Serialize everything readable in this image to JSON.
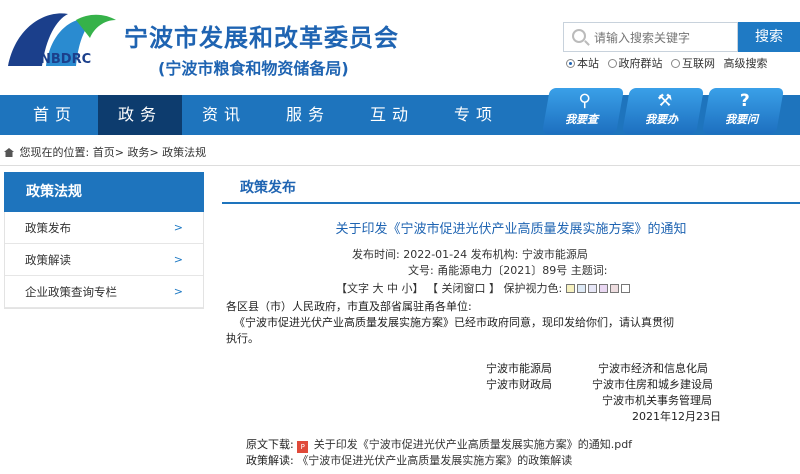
{
  "header": {
    "logo_text": "NBDRC",
    "title": "宁波市发展和改革委员会",
    "subtitle": "(宁波市粮食和物资储备局)"
  },
  "search": {
    "placeholder": "请输入搜索关键字",
    "button": "搜索",
    "options": [
      "本站",
      "政府群站",
      "互联网",
      "高级搜索"
    ]
  },
  "nav": {
    "items": [
      "首页",
      "政务",
      "资讯",
      "服务",
      "互动",
      "专项"
    ]
  },
  "quick_links": [
    {
      "icon": "search-icon",
      "label": "我要查"
    },
    {
      "icon": "tools-icon",
      "label": "我要办"
    },
    {
      "icon": "question-icon",
      "label": "我要问"
    }
  ],
  "breadcrumb": {
    "prefix": "您现在的位置:",
    "items": [
      "首页",
      "政务",
      "政策法规"
    ]
  },
  "sidebar": {
    "title": "政策法规",
    "items": [
      "政策发布",
      "政策解读",
      "企业政策查询专栏"
    ]
  },
  "main": {
    "section_title": "政策发布",
    "article_title": "关于印发《宁波市促进光伏产业高质量发展实施方案》的通知",
    "meta_line1": "发布时间: 2022-01-24 发布机构: 宁波市能源局",
    "meta_line2": "文号: 甬能源电力〔2021〕89号 主题词:",
    "toolbar": {
      "font_label": "【文字",
      "size_large": "大",
      "size_mid": "中",
      "size_small": "小】",
      "close": "【 关闭窗口 】",
      "eye_care": "保护视力色:"
    },
    "swatch_colors": [
      "#f7f2c0",
      "#dde9f6",
      "#e7e7f7",
      "#e9d7f2",
      "#eedde0",
      "#ffffff"
    ],
    "recipients": "各区县（市）人民政府，市直及部省属驻甬各单位:",
    "body": "《宁波市促进光伏产业高质量发展实施方案》已经市政府同意，现印发给你们，请认真贯彻执行。",
    "body_line1": "《宁波市促进光伏产业高质量发展实施方案》已经市政府同意，现印发给你们，请认真贯彻",
    "body_line2": "执行。",
    "signatories": [
      "宁波市能源局",
      "宁波市经济和信息化局",
      "宁波市财政局",
      "宁波市住房和城乡建设局",
      "宁波市机关事务管理局"
    ],
    "sign_date": "2021年12月23日",
    "attachment_label": "原文下载:",
    "attachment_name": "关于印发《宁波市促进光伏产业高质量发展实施方案》的通知.pdf",
    "interpretation_label": "政策解读:",
    "interpretation_name": "《宁波市促进光伏产业高质量发展实施方案》的政策解读"
  }
}
